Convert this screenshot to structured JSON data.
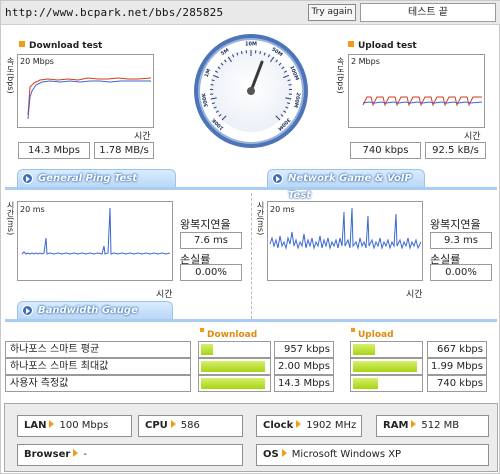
{
  "topbar": {
    "url": "http://www.bcpark.net/bbs/285825",
    "try_again": "Try again",
    "status": "테스트 끝"
  },
  "download": {
    "title": "Download test",
    "scale": "20 Mbps",
    "ylabel": "속도(bps)",
    "xlabel": "시간",
    "value_mbps": "14.3 Mbps",
    "value_mbs": "1.78 MB/s"
  },
  "upload": {
    "title": "Upload test",
    "scale": "2 Mbps",
    "ylabel": "속도(bps)",
    "xlabel": "시간",
    "value_kbps": "740 kbps",
    "value_kbs": "92.5 kB/s"
  },
  "gauge": {
    "labels": [
      "100K",
      "300K",
      "1M",
      "5M",
      "10M",
      "50M",
      "100M",
      "200M",
      "300M"
    ]
  },
  "ping": {
    "tab": "General Ping Test",
    "scale": "20 ms",
    "ylabel": "시간(ms)",
    "xlabel": "시간",
    "rtt_label": "왕복지연율",
    "rtt_value": "7.6 ms",
    "loss_label": "손실률",
    "loss_value": "0.00%"
  },
  "game": {
    "tab": "Network Game & VoIP Test",
    "scale": "20 ms",
    "ylabel": "시간(ms)",
    "xlabel": "시간",
    "rtt_label": "왕복지연율",
    "rtt_value": "9.3 ms",
    "loss_label": "손실률",
    "loss_value": "0.00%"
  },
  "bandwidth": {
    "tab": "Bandwidth Gauge",
    "download_header": "Download",
    "upload_header": "Upload",
    "rows": [
      {
        "label": "하나포스 스마트 평균",
        "down_value": "957 kbps",
        "down_fill": 0.18,
        "up_value": "667 kbps",
        "up_fill": 0.33
      },
      {
        "label": "하나포스 스마트 최대값",
        "down_value": "2.00 Mbps",
        "down_fill": 0.95,
        "up_value": "1.99 Mbps",
        "up_fill": 0.95
      },
      {
        "label": "사용자 측정값",
        "down_value": "14.3 Mbps",
        "down_fill": 0.95,
        "up_value": "740 kbps",
        "up_fill": 0.37
      }
    ]
  },
  "system": {
    "lan_label": "LAN",
    "lan_value": "100 Mbps",
    "cpu_label": "CPU",
    "cpu_value": "586",
    "clock_label": "Clock",
    "clock_value": "1902 MHz",
    "ram_label": "RAM",
    "ram_value": "512 MB",
    "browser_label": "Browser",
    "browser_value": "-",
    "os_label": "OS",
    "os_value": "Microsoft Windows XP"
  },
  "colors": {
    "accent_orange": "#f39a1a",
    "tab_blue": "#b7d6f5",
    "bar_green": "#a8d414",
    "plot_blue": "#3b66d6",
    "plot_red": "#d83a1c"
  }
}
